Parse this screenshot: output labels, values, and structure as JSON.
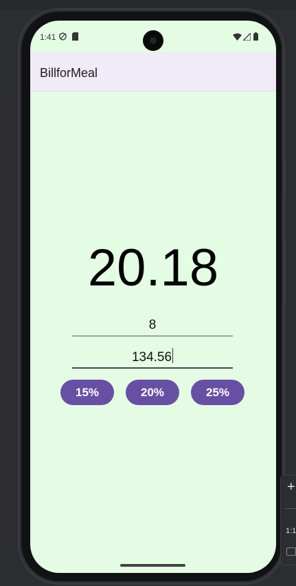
{
  "status": {
    "time": "1:41"
  },
  "app": {
    "title": "BillforMeal"
  },
  "tip_amount": "20.18",
  "inputs": {
    "people": "8",
    "bill": "134.56"
  },
  "buttons": [
    {
      "label": "15%"
    },
    {
      "label": "20%"
    },
    {
      "label": "25%"
    }
  ],
  "side_panel": {
    "label": "1:1",
    "icon": "plus-icon"
  },
  "colors": {
    "screen_bg": "#e4fbe4",
    "appbar_bg": "#f0ebf7",
    "accent": "#6750a4"
  }
}
